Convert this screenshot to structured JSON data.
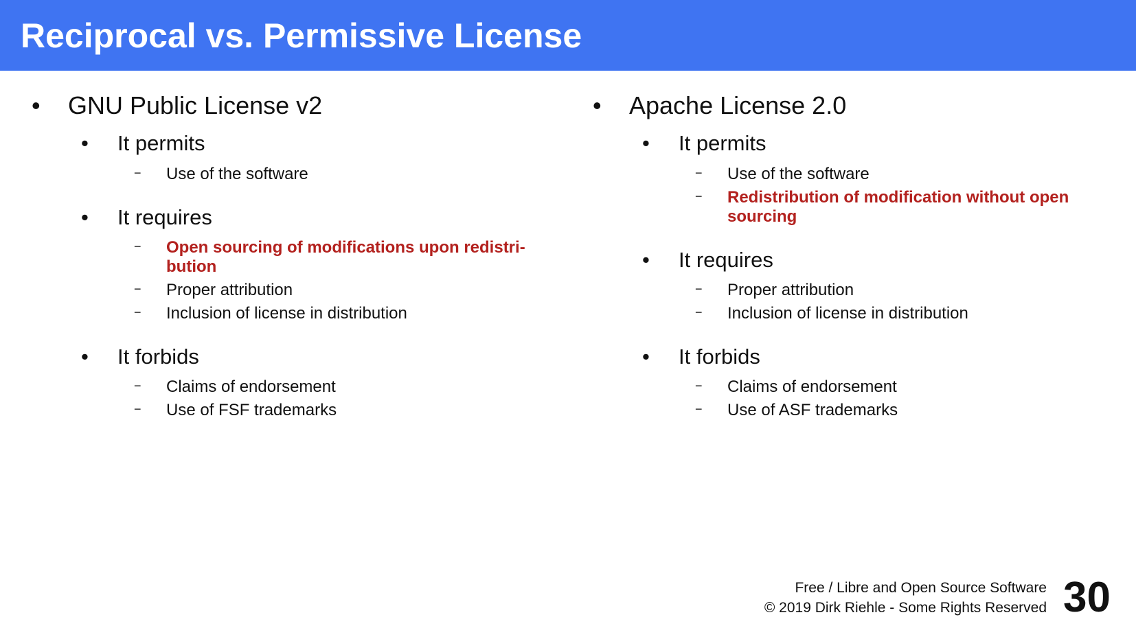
{
  "slide": {
    "title": "Reciprocal vs. Permissive License",
    "colors": {
      "title_bar": "#3f74f2",
      "title_text": "#ffffff",
      "highlight": "#b3211e",
      "body_text": "#111111"
    }
  },
  "left": {
    "heading": "GNU Public License v2",
    "permits": {
      "label": "It permits",
      "items": [
        "Use of the software"
      ]
    },
    "requires": {
      "label": "It requires",
      "items": [
        "Open sourcing of modifications upon redistri-bution",
        "Proper attribution",
        "Inclusion of license in distribution"
      ]
    },
    "forbids": {
      "label": "It forbids",
      "items": [
        "Claims of endorsement",
        "Use of FSF trademarks"
      ]
    }
  },
  "right": {
    "heading": "Apache License 2.0",
    "permits": {
      "label": "It permits",
      "items": [
        "Use of the software",
        "Redistribution of modification without open sourcing"
      ]
    },
    "requires": {
      "label": "It requires",
      "items": [
        "Proper attribution",
        "Inclusion of license in distribution"
      ]
    },
    "forbids": {
      "label": "It forbids",
      "items": [
        "Claims of endorsement",
        "Use of ASF trademarks"
      ]
    }
  },
  "footer": {
    "line1": "Free / Libre and Open Source Software",
    "line2": "© 2019 Dirk Riehle - Some Rights Reserved",
    "page_number": "30"
  }
}
